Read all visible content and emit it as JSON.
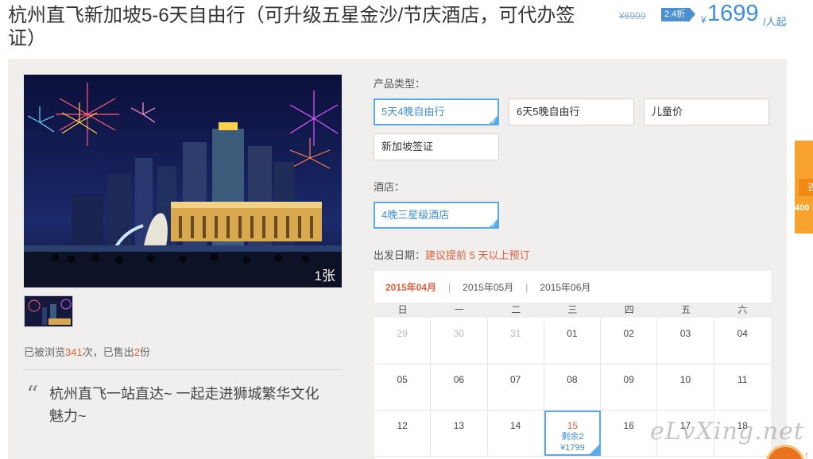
{
  "product": {
    "title": "杭州直飞新加坡5-6天自由行（可升级五星金沙/节庆酒店，可代办签证）"
  },
  "price": {
    "original": "¥6999",
    "discount": "2.4折",
    "currency": "¥",
    "current": "1699",
    "unit": "/人起"
  },
  "gallery": {
    "photo_count": "1张"
  },
  "stats": {
    "viewed_prefix": "已被浏览",
    "viewed_count": "341",
    "viewed_suffix": "次，已售出",
    "sold_count": "2",
    "sold_suffix": "份"
  },
  "quote": {
    "mark": "“",
    "text": "杭州直飞一站直达~ 一起走进狮城繁华文化魅力~"
  },
  "product_type": {
    "label": "产品类型：",
    "options": [
      "5天4晚自由行",
      "6天5晚自由行",
      "儿童价",
      "新加坡签证"
    ],
    "selected": "5天4晚自由行"
  },
  "hotel": {
    "label": "酒店：",
    "options": [
      "4晚三星级酒店"
    ],
    "selected": "4晚三星级酒店"
  },
  "departure": {
    "label": "出发日期：",
    "hint": "建议提前 5 天以上预订"
  },
  "calendar": {
    "months": [
      "2015年04月",
      "2015年05月",
      "2015年06月"
    ],
    "active_month": "2015年04月",
    "separator": "|",
    "weekdays": [
      "日",
      "一",
      "二",
      "三",
      "四",
      "五",
      "六"
    ],
    "weeks": [
      [
        "29",
        "30",
        "31",
        "01",
        "02",
        "03",
        "04"
      ],
      [
        "05",
        "06",
        "07",
        "08",
        "09",
        "10",
        "11"
      ],
      [
        "12",
        "13",
        "14",
        "15",
        "16",
        "17",
        "18"
      ]
    ],
    "available_day": {
      "day": "15",
      "remaining": "剩余2",
      "price": "¥1799"
    }
  },
  "side_tab": {
    "text": "咨",
    "phone": "400"
  },
  "watermark": "eLvXing.net",
  "back_to_top": "↑",
  "colors": {
    "accent_blue": "#3e8fdb",
    "accent_orange": "#e55f3b",
    "selected_border": "#5aaaea",
    "side_tab": "#f7a12f"
  }
}
